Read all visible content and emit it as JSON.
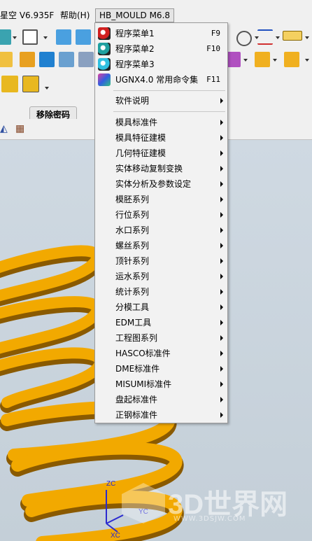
{
  "menubar": {
    "item1": "星空 V6.935F",
    "item2": "帮助(H)",
    "item3": "HB_MOULD M6.8"
  },
  "tooltip": {
    "text": "移除密码"
  },
  "menu": {
    "top_items": [
      {
        "label": "程序菜单1",
        "shortcut": "F9",
        "icon": "red-yinyang-icon"
      },
      {
        "label": "程序菜单2",
        "shortcut": "F10",
        "icon": "teal-yinyang-icon"
      },
      {
        "label": "程序菜单3",
        "shortcut": "",
        "icon": "cyan-yinyang-icon"
      },
      {
        "label": "UGNX4.0 常用命令集",
        "shortcut": "F11",
        "icon": "ugnx-app-icon"
      }
    ],
    "about": "软件说明",
    "submenus": [
      "模具标准件",
      "模具特征建模",
      "几何特征建模",
      "实体移动复制变换",
      "实体分析及参数设定",
      "模胚系列",
      "行位系列",
      "水口系列",
      "螺丝系列",
      "顶针系列",
      "运水系列",
      "统计系列",
      "分模工具",
      "EDM工具",
      "工程图系列",
      "HASCO标准件",
      "DME标准件",
      "MISUMI标准件",
      "盘起标准件",
      "正钢标准件"
    ]
  },
  "axes": {
    "zc": "ZC",
    "yc": "YC",
    "xc": "XC"
  },
  "watermark": {
    "brand": "3D世界网",
    "url": "WWW.3DSJW.COM"
  },
  "colors": {
    "spring": "#f2a900",
    "menu_bg": "#f2f2f2",
    "viewport_bg": "#c7d3dd"
  }
}
